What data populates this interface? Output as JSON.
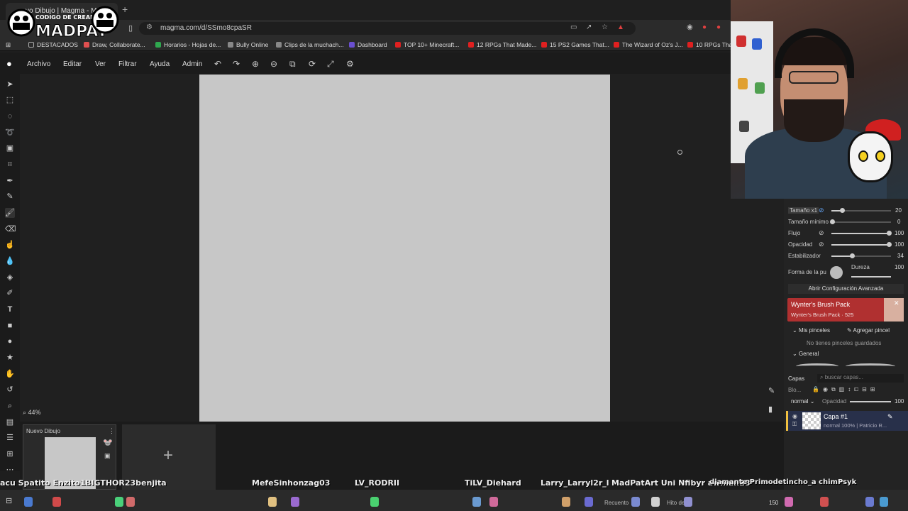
{
  "browser": {
    "tab_title": "vo Dibujo | Magma - Multi",
    "new_tab": "+",
    "url": "magma.com/d/SSmo8cpaSR",
    "overlay_logo": {
      "line1": "CODIGO DE CREADOR",
      "line2": "MADPAT"
    }
  },
  "bookmarks": [
    {
      "label": "DESTACADOS",
      "color": "#777777"
    },
    {
      "label": "Draw, Collaborate...",
      "color": "#e05050"
    },
    {
      "label": "Horarios - Hojas de...",
      "color": "#2fa84f"
    },
    {
      "label": "Bully Online",
      "color": "#888888"
    },
    {
      "label": "Clips de la muchach...",
      "color": "#888888"
    },
    {
      "label": "Dashboard",
      "color": "#6a4fd0"
    },
    {
      "label": "TOP 10+ Minecraft...",
      "color": "#e02020"
    },
    {
      "label": "12 RPGs That Made...",
      "color": "#e02020"
    },
    {
      "label": "15 PS2 Games That...",
      "color": "#e02020"
    },
    {
      "label": "The Wizard of Oz's J...",
      "color": "#e02020"
    },
    {
      "label": "10 RPGs That",
      "color": "#e02020"
    }
  ],
  "menubar": {
    "items": [
      "Archivo",
      "Editar",
      "Ver",
      "Filtrar",
      "Ayuda",
      "Admin"
    ],
    "toolbar_icons": [
      "undo-icon",
      "redo-icon",
      "zoom-in-icon",
      "zoom-out-icon",
      "fit-icon",
      "rotate-icon",
      "fullscreen-icon",
      "settings-icon"
    ]
  },
  "left_tools": [
    "move-tool-icon",
    "rect-select-icon",
    "ellipse-select-icon",
    "lasso-icon",
    "transform-icon",
    "crop-icon",
    "pen-icon",
    "pencil-icon",
    "brush-icon",
    "eraser-icon",
    "smudge-icon",
    "blur-icon",
    "fill-icon",
    "color-picker-icon",
    "text-icon",
    "rectangle-icon",
    "ellipse-icon",
    "star-icon",
    "hand-icon",
    "rotate-view-icon",
    "zoom-tool-icon",
    "chat-icon",
    "hash-icon",
    "add-icon",
    "more-icon"
  ],
  "canvas": {
    "zoom_label": "44%"
  },
  "brush_panel": {
    "rows": [
      {
        "label": "Tamaño x1",
        "value": "20",
        "fraction": 0.08
      },
      {
        "label": "Tamaño mínimo",
        "value": "0",
        "fraction": 0.0
      },
      {
        "label": "Flujo",
        "value": "100",
        "fraction": 1.0
      },
      {
        "label": "Opacidad",
        "value": "100",
        "fraction": 1.0
      },
      {
        "label": "Estabilizador",
        "value": "34",
        "fraction": 0.34
      }
    ],
    "shape_label": "Forma de la pu",
    "hardness_label": "Dureza",
    "hardness_value": "100",
    "advanced_button": "Abrir Configuración Avanzada",
    "pack_title": "Wynter's Brush Pack",
    "pack_subtitle": "Wynter's Brush Pack · 525",
    "my_brushes": "Mis pinceles",
    "add_brush": "Agregar pincel",
    "no_brushes": "No tienes pinceles guardados",
    "general": "General"
  },
  "layers": {
    "title": "Capas",
    "search_placeholder": "buscar capas...",
    "blend_label": "Blo...",
    "blend_mode": "normal",
    "opacity_label": "Opacidad",
    "opacity_value": "100",
    "opacity_fraction": 1.0,
    "items": [
      {
        "name": "Capa #1",
        "meta": "normal 100% | Patricio R..."
      }
    ]
  },
  "drawings": {
    "current_title": "Nuevo Dibujo",
    "add_label": "+"
  },
  "chat_names": [
    "acu Spatito Enzito1",
    "BIGTHOR23benjita",
    "MefeSinhonzag03",
    "LV_RODRII",
    "TiLV_Diehard",
    "Larry_Larryl2r_l",
    "MadPatArt Uni Nfibyr awman18",
    "diamante Primodetincho_a chimPsyk"
  ],
  "status_bar": {
    "left": "Recuento",
    "middle": "Hito de",
    "right": "150"
  },
  "colors": {
    "accent": "#f0c040",
    "pack": "#b03030",
    "layer_selected": "#28304a",
    "canvas": "#c7c7c7"
  }
}
